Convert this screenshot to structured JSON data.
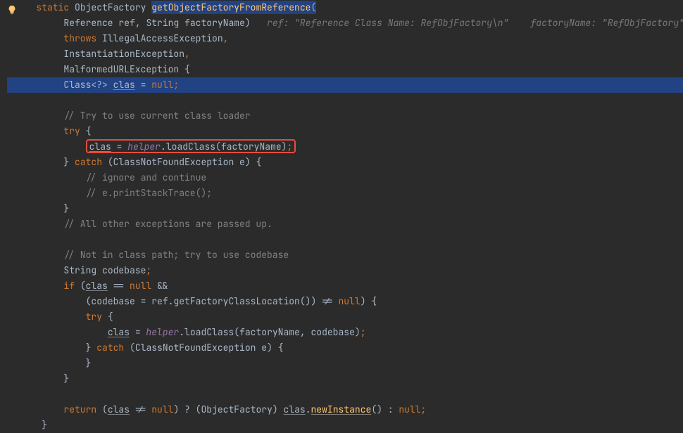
{
  "code": {
    "l1": {
      "kw_static": "static",
      "type": "ObjectFactory",
      "method": "getObjectFactoryFromReference",
      "paren": "("
    },
    "l2": {
      "type1": "Reference",
      "p1": "ref",
      "c1": ", ",
      "type2": "String",
      "p2": "factoryName",
      "paren": ")",
      "hint1": "ref: \"Reference Class Name: RefObjFactory\\n\"",
      "hint2": "factoryName: \"RefObjFactory\""
    },
    "l3": {
      "kw_throws": "throws",
      "ex": "IllegalAccessException",
      "c": ","
    },
    "l4": {
      "ex": "InstantiationException",
      "c": ","
    },
    "l5": {
      "ex": "MalformedURLException",
      "brace": " {"
    },
    "l6": {
      "type": "Class",
      "gen": "<?> ",
      "var": "clas",
      "eq": " = ",
      "val": "null",
      "semi": ";"
    },
    "l8": {
      "comment": "// Try to use current class loader"
    },
    "l9": {
      "kw": "try",
      "brace": " {"
    },
    "l10": {
      "var": "clas",
      "eq": " = ",
      "helper": "helper",
      "dot": ".",
      "method": "loadClass",
      "po": "(",
      "arg": "factoryName",
      "pc": ")",
      "semi": ";"
    },
    "l11": {
      "brace": "}",
      "kw": " catch ",
      "po": "(",
      "type": "ClassNotFoundException",
      "p": " e",
      "pc": ")",
      "brace2": " {"
    },
    "l12": {
      "comment": "// ignore and continue"
    },
    "l13": {
      "comment": "// e.printStackTrace();"
    },
    "l14": {
      "brace": "}"
    },
    "l15": {
      "comment": "// All other exceptions are passed up."
    },
    "l17": {
      "comment": "// Not in class path; try to use codebase"
    },
    "l18": {
      "type": "String",
      "var": " codebase",
      "semi": ";"
    },
    "l19": {
      "kw": "if",
      "po": " (",
      "var": "clas",
      "eq": " == ",
      "val": "null",
      "and": " &&"
    },
    "l20": {
      "po": "(",
      "var1": "codebase",
      "eq": " = ",
      "var2": "ref",
      "dot": ".",
      "method": "getFactoryClassLocation",
      "po2": "()",
      "pc": ")",
      "neq": " != ",
      "val": "null",
      "pc2": ")",
      "brace": " {"
    },
    "l21": {
      "kw": "try",
      "brace": " {"
    },
    "l22": {
      "var": "clas",
      "eq": " = ",
      "helper": "helper",
      "dot": ".",
      "method": "loadClass",
      "po": "(",
      "arg1": "factoryName",
      "c": ", ",
      "arg2": "codebase",
      "pc": ")",
      "semi": ";"
    },
    "l23": {
      "brace": "}",
      "kw": " catch ",
      "po": "(",
      "type": "ClassNotFoundException",
      "p": " e",
      "pc": ")",
      "brace2": " {"
    },
    "l24": {
      "brace": "}"
    },
    "l25": {
      "brace": "}"
    },
    "l27": {
      "kw": "return",
      "po": " (",
      "var": "clas",
      "neq": " != ",
      "val": "null",
      "pc": ")",
      "q": " ? ",
      "po2": "(",
      "type": "ObjectFactory",
      "pc2": ") ",
      "var2": "clas",
      "dot": ".",
      "method": "newInstance",
      "po3": "()",
      "col": " : ",
      "val2": "null",
      "semi": ";"
    },
    "l28": {
      "brace": "}"
    }
  },
  "icons": {
    "bulb": "bulb-icon"
  }
}
